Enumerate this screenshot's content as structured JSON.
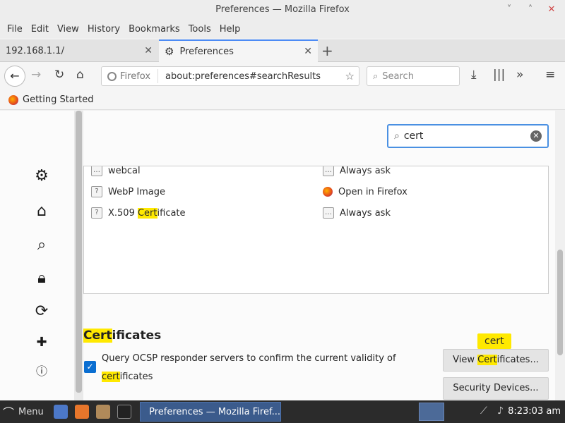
{
  "window": {
    "title": "Preferences — Mozilla Firefox",
    "controls": [
      "˅",
      "˄",
      "✕"
    ]
  },
  "menubar": [
    "File",
    "Edit",
    "View",
    "History",
    "Bookmarks",
    "Tools",
    "Help"
  ],
  "tabs": [
    {
      "label": "192.168.1.1/",
      "active": false
    },
    {
      "label": "Preferences",
      "active": true
    }
  ],
  "navbar": {
    "identity": "Firefox",
    "url": "about:preferences#searchResults",
    "search_placeholder": "Search"
  },
  "bookmarks": {
    "getting_started": "Getting Started"
  },
  "prefs_search": {
    "value": "cert"
  },
  "applications": [
    {
      "type": "webcal",
      "action": "Always ask"
    },
    {
      "type_prefix": "WebP Image",
      "action": "Open in Firefox"
    },
    {
      "type_prefix": "X.509 ",
      "type_highlight": "Cert",
      "type_suffix": "ificate",
      "action": "Always ask"
    }
  ],
  "certificates": {
    "heading_highlight": "Cert",
    "heading_rest": "ificates",
    "ocsp_line1": "Query OCSP responder servers to confirm the current validity of",
    "ocsp_hl": "cert",
    "ocsp_rest": "ificates",
    "ocsp_checked": true,
    "tooltip": "cert",
    "view_btn_pre": "View ",
    "view_btn_hl": "Cert",
    "view_btn_post": "ificates...",
    "security_btn_pre": "Security ",
    "security_btn_rest": "Devices..."
  },
  "taskbar": {
    "menu": "Menu",
    "task_title": "Preferences — Mozilla Firef...",
    "clock": "8:23:03 am"
  }
}
